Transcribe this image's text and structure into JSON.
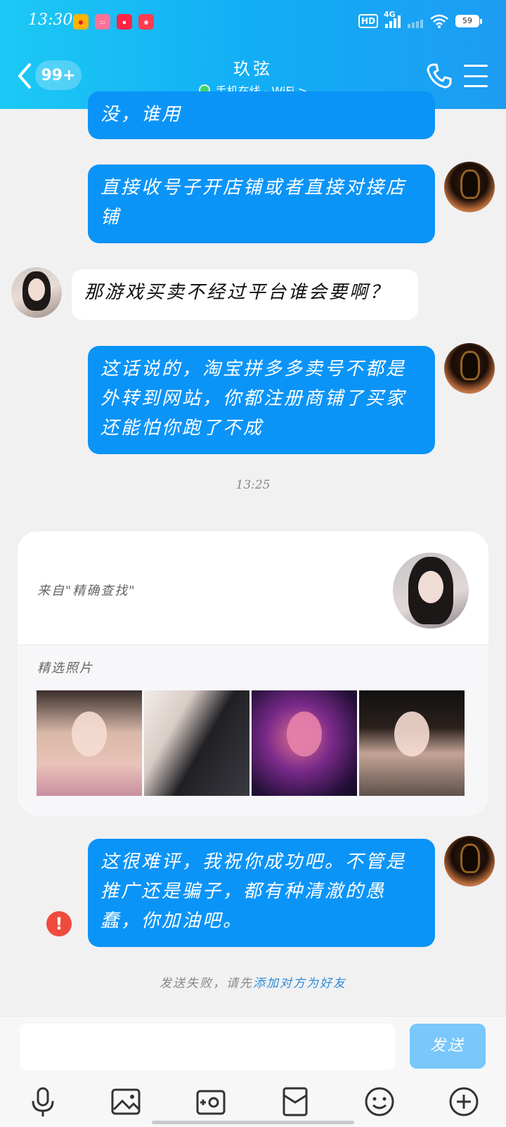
{
  "status_bar": {
    "time": "13:30",
    "network": "4G",
    "hd": "HD",
    "battery": "59",
    "app_icons": [
      "weibo-icon",
      "bilibili-icon",
      "xiaohongshu-icon",
      "social-app-icon"
    ]
  },
  "header": {
    "unread_count": "99+",
    "contact_name": "玖弦",
    "presence": "手机在线 - WiFi >"
  },
  "messages": [
    {
      "side": "me",
      "text": "没，谁用"
    },
    {
      "side": "me",
      "text": "直接收号子开店铺或者直接对接店铺"
    },
    {
      "side": "them",
      "text": "那游戏买卖不经过平台谁会要啊？"
    },
    {
      "side": "me",
      "text": "这话说的，淘宝拼多多卖号不都是外转到网站，你都注册商铺了买家还能怕你跑了不成"
    }
  ],
  "timestamp": "13:25",
  "profile_card": {
    "source": "来自\"精确查找\"",
    "photos_label": "精选照片"
  },
  "last_message": {
    "side": "me",
    "text": "这很难评，我祝你成功吧。不管是推广还是骗子，都有种清澈的愚蠢，你加油吧。"
  },
  "error": {
    "icon": "!",
    "prefix": "发送失败，请先",
    "link": "添加对方为好友"
  },
  "input": {
    "placeholder": "",
    "send_label": "发送"
  },
  "colors": {
    "header_start": "#1cc9f5",
    "header_end": "#1d9cf2",
    "my_bubble": "#0b94f7",
    "send_button": "#79c7fb",
    "error": "#f04a3e"
  }
}
